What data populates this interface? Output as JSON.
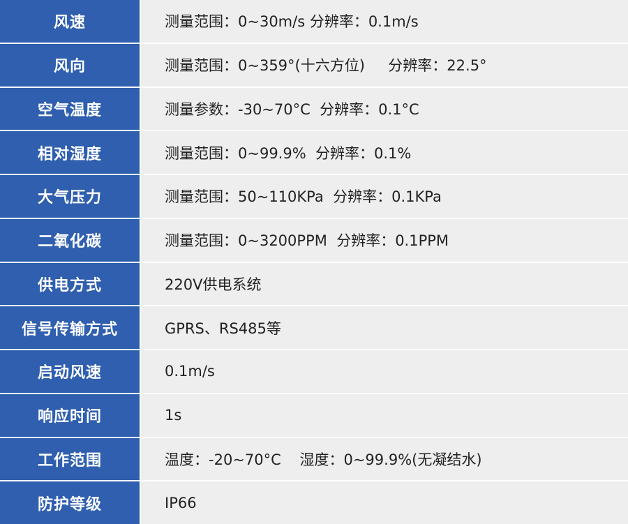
{
  "rows": [
    {
      "label": "风速",
      "value": "测量范围：0~30m/s 分辨率：0.1m/s"
    },
    {
      "label": "风向",
      "value": "测量范围：0~359°(十六方位)     分辨率：22.5°"
    },
    {
      "label": "空气温度",
      "value": "测量参数：-30~70°C  分辨率：0.1°C"
    },
    {
      "label": "相对湿度",
      "value": "测量范围：0~99.9%  分辨率：0.1%"
    },
    {
      "label": "大气压力",
      "value": "测量范围：50~110KPa  分辨率：0.1KPa"
    },
    {
      "label": "二氧化碳",
      "value": "测量范围：0~3200PPM  分辨率：0.1PPM"
    },
    {
      "label": "供电方式",
      "value": "220V供电系统"
    },
    {
      "label": "信号传输方式",
      "value": "GPRS、RS485等"
    },
    {
      "label": "启动风速",
      "value": "0.1m/s"
    },
    {
      "label": "响应时间",
      "value": "1s"
    },
    {
      "label": "工作范围",
      "value": "温度：-20~70°C    湿度：0~99.9%(无凝结水)"
    },
    {
      "label": "防护等级",
      "value": "IP66"
    }
  ],
  "colors": {
    "label_background": "#2f5fae",
    "value_background": "#eeeeee"
  }
}
